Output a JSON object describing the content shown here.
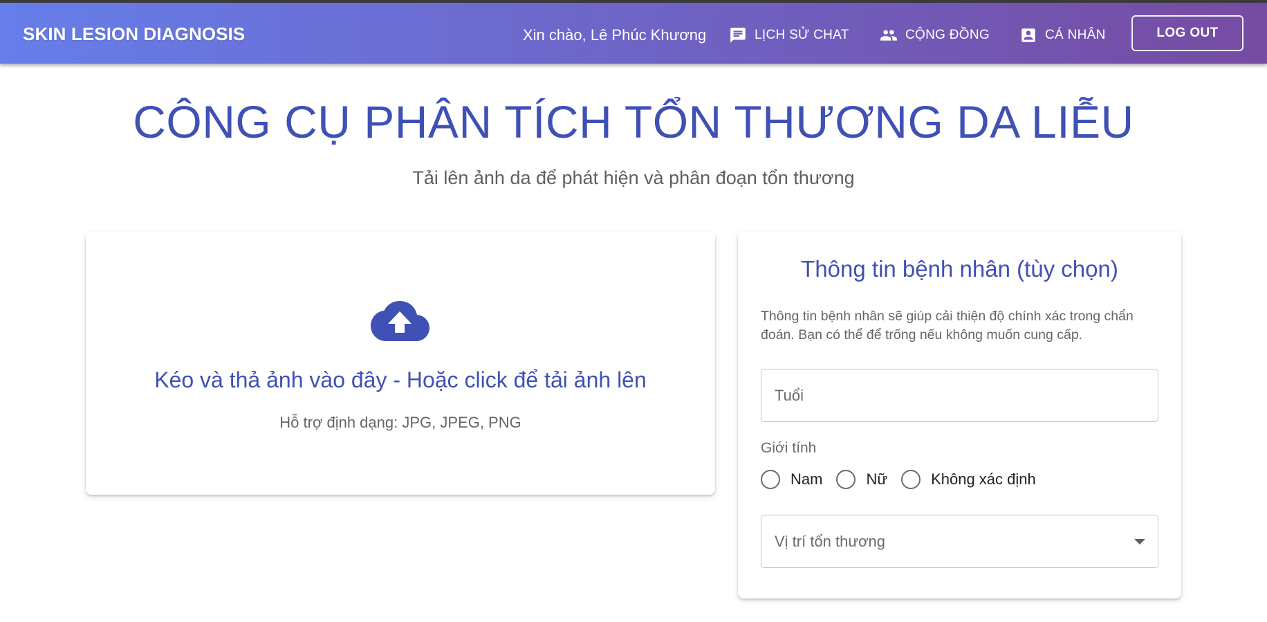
{
  "app": {
    "title": "SKIN LESION DIAGNOSIS",
    "greeting": "Xin chào, Lê Phúc Khương",
    "nav": [
      {
        "label": "LỊCH SỬ CHAT",
        "icon": "chat-icon"
      },
      {
        "label": "CỘNG ĐỒNG",
        "icon": "people-icon"
      },
      {
        "label": "CÁ NHÂN",
        "icon": "account-box-icon"
      }
    ],
    "logout_label": "LOG OUT"
  },
  "page": {
    "title": "CÔNG CỤ PHÂN TÍCH TỔN THƯƠNG DA LIỄU",
    "subtitle": "Tải lên ảnh da để phát hiện và phân đoạn tổn thương"
  },
  "upload": {
    "icon": "cloud-upload-icon",
    "title": "Kéo và thả ảnh vào đây - Hoặc click để tải ảnh lên",
    "hint": "Hỗ trợ định dạng: JPG, JPEG, PNG"
  },
  "patient": {
    "title": "Thông tin bệnh nhân (tùy chọn)",
    "description": "Thông tin bệnh nhân sẽ giúp cải thiện độ chính xác trong chẩn đoán. Bạn có thể để trống nếu không muốn cung cấp.",
    "age_label": "Tuổi",
    "gender_label": "Giới tính",
    "gender_options": [
      "Nam",
      "Nữ",
      "Không xác định"
    ],
    "location_label": "Vị trí tổn thương"
  },
  "colors": {
    "gradient_start": "#667eea",
    "gradient_end": "#764ba2",
    "primary": "#3f51b5"
  }
}
